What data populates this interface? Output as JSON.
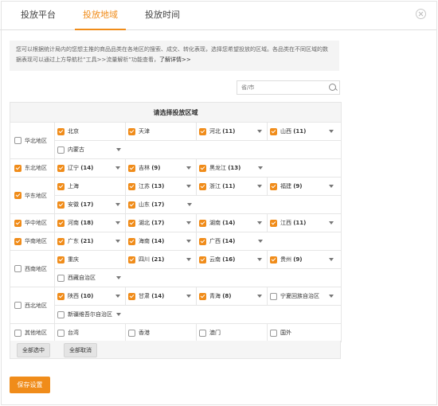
{
  "tabs": [
    "投放平台",
    "投放地域",
    "投放时间"
  ],
  "notice": {
    "text": "您可以根据统计局内的您想主推的商品品类在各地区的搜索、成交、转化表现，选择您希望投放的区域。各品类在不同区域的数据表现可以通过上方导航栏“工具>>流量解析”功能查看，",
    "link": "了解详情>>"
  },
  "search": {
    "placeholder": "省/市"
  },
  "table": {
    "header": "请选择投放区域",
    "regions": [
      {
        "name": "华北地区",
        "checked": false,
        "rows": [
          [
            {
              "name": "北京",
              "checked": true,
              "arrow": false
            },
            {
              "name": "天津",
              "checked": true,
              "arrow": false
            },
            {
              "name": "河北",
              "count": "(11)",
              "checked": true,
              "arrow": true
            },
            {
              "name": "山西",
              "count": "(11)",
              "checked": true,
              "arrow": true
            }
          ],
          [
            {
              "name": "内蒙古",
              "checked": false,
              "arrow": true
            }
          ]
        ]
      },
      {
        "name": "东北地区",
        "checked": true,
        "rows": [
          [
            {
              "name": "辽宁",
              "count": "(14)",
              "checked": true,
              "arrow": true
            },
            {
              "name": "吉林",
              "count": "(9)",
              "checked": true,
              "arrow": true
            },
            {
              "name": "黑龙江",
              "count": "(13)",
              "checked": true,
              "arrow": true
            }
          ]
        ]
      },
      {
        "name": "华东地区",
        "checked": true,
        "rows": [
          [
            {
              "name": "上海",
              "checked": true,
              "arrow": false
            },
            {
              "name": "江苏",
              "count": "(13)",
              "checked": true,
              "arrow": true
            },
            {
              "name": "浙江",
              "count": "(11)",
              "checked": true,
              "arrow": true
            },
            {
              "name": "福建",
              "count": "(9)",
              "checked": true,
              "arrow": true
            }
          ],
          [
            {
              "name": "安徽",
              "count": "(17)",
              "checked": true,
              "arrow": true
            },
            {
              "name": "山东",
              "count": "(17)",
              "checked": true,
              "arrow": true
            }
          ]
        ]
      },
      {
        "name": "华中地区",
        "checked": true,
        "rows": [
          [
            {
              "name": "河南",
              "count": "(18)",
              "checked": true,
              "arrow": true
            },
            {
              "name": "湖北",
              "count": "(17)",
              "checked": true,
              "arrow": true
            },
            {
              "name": "湖南",
              "count": "(14)",
              "checked": true,
              "arrow": true
            },
            {
              "name": "江西",
              "count": "(11)",
              "checked": true,
              "arrow": true
            }
          ]
        ]
      },
      {
        "name": "华南地区",
        "checked": true,
        "rows": [
          [
            {
              "name": "广东",
              "count": "(21)",
              "checked": true,
              "arrow": true
            },
            {
              "name": "海南",
              "count": "(14)",
              "checked": true,
              "arrow": true
            },
            {
              "name": "广西",
              "count": "(14)",
              "checked": true,
              "arrow": true
            }
          ]
        ]
      },
      {
        "name": "西南地区",
        "checked": false,
        "rows": [
          [
            {
              "name": "重庆",
              "checked": true,
              "arrow": false
            },
            {
              "name": "四川",
              "count": "(21)",
              "checked": true,
              "arrow": true
            },
            {
              "name": "云南",
              "count": "(16)",
              "checked": true,
              "arrow": true
            },
            {
              "name": "贵州",
              "count": "(9)",
              "checked": true,
              "arrow": true
            }
          ],
          [
            {
              "name": "西藏自治区",
              "checked": false,
              "arrow": true
            }
          ]
        ]
      },
      {
        "name": "西北地区",
        "checked": false,
        "rows": [
          [
            {
              "name": "陕西",
              "count": "(10)",
              "checked": true,
              "arrow": true
            },
            {
              "name": "甘肃",
              "count": "(14)",
              "checked": true,
              "arrow": true
            },
            {
              "name": "青海",
              "count": "(8)",
              "checked": true,
              "arrow": true
            },
            {
              "name": "宁夏回族自治区",
              "checked": false,
              "arrow": true
            }
          ],
          [
            {
              "name": "新疆维吾尔自治区",
              "checked": false,
              "arrow": true
            }
          ]
        ]
      },
      {
        "name": "其他地区",
        "checked": false,
        "rows": [
          [
            {
              "name": "台湾",
              "checked": false,
              "arrow": false
            },
            {
              "name": "香港",
              "checked": false,
              "arrow": false
            },
            {
              "name": "澳门",
              "checked": false,
              "arrow": false
            },
            {
              "name": "国外",
              "checked": false,
              "arrow": false
            }
          ]
        ]
      }
    ]
  },
  "buttons": {
    "select_all": "全部选中",
    "cancel_all": "全部取消"
  },
  "save": "保存设置",
  "colors": {
    "accent": "#f08c1a"
  }
}
